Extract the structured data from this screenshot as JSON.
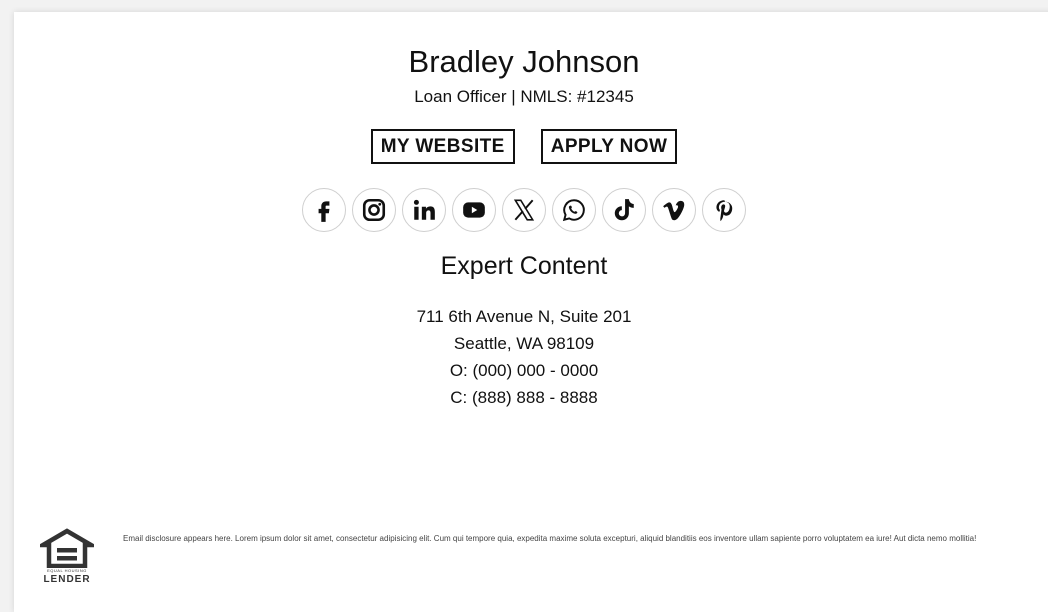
{
  "signature": {
    "name": "Bradley Johnson",
    "title": "Loan Officer | NMLS: #12345",
    "buttons": [
      "MY WEBSITE",
      "APPLY NOW"
    ],
    "social_icons": [
      "facebook-icon",
      "instagram-icon",
      "linkedin-icon",
      "youtube-icon",
      "x-icon",
      "whatsapp-icon",
      "tiktok-icon",
      "vimeo-icon",
      "pinterest-icon"
    ],
    "company": "Expert Content",
    "address_line1": "711 6th Avenue N, Suite 201",
    "address_line2": "Seattle, WA 98109",
    "office_phone": "O: (000) 000 - 0000",
    "cell_phone": "C: (888) 888 - 8888"
  },
  "footer": {
    "logo_small": "EQUAL HOUSING",
    "logo_word": "LENDER",
    "disclosure": "Email disclosure appears here. Lorem ipsum dolor sit amet, consectetur adipisicing elit. Cum qui tempore quia, expedita maxime soluta excepturi, aliquid blanditiis eos inventore ullam sapiente porro voluptatem ea iure! Aut dicta nemo mollitia!"
  }
}
